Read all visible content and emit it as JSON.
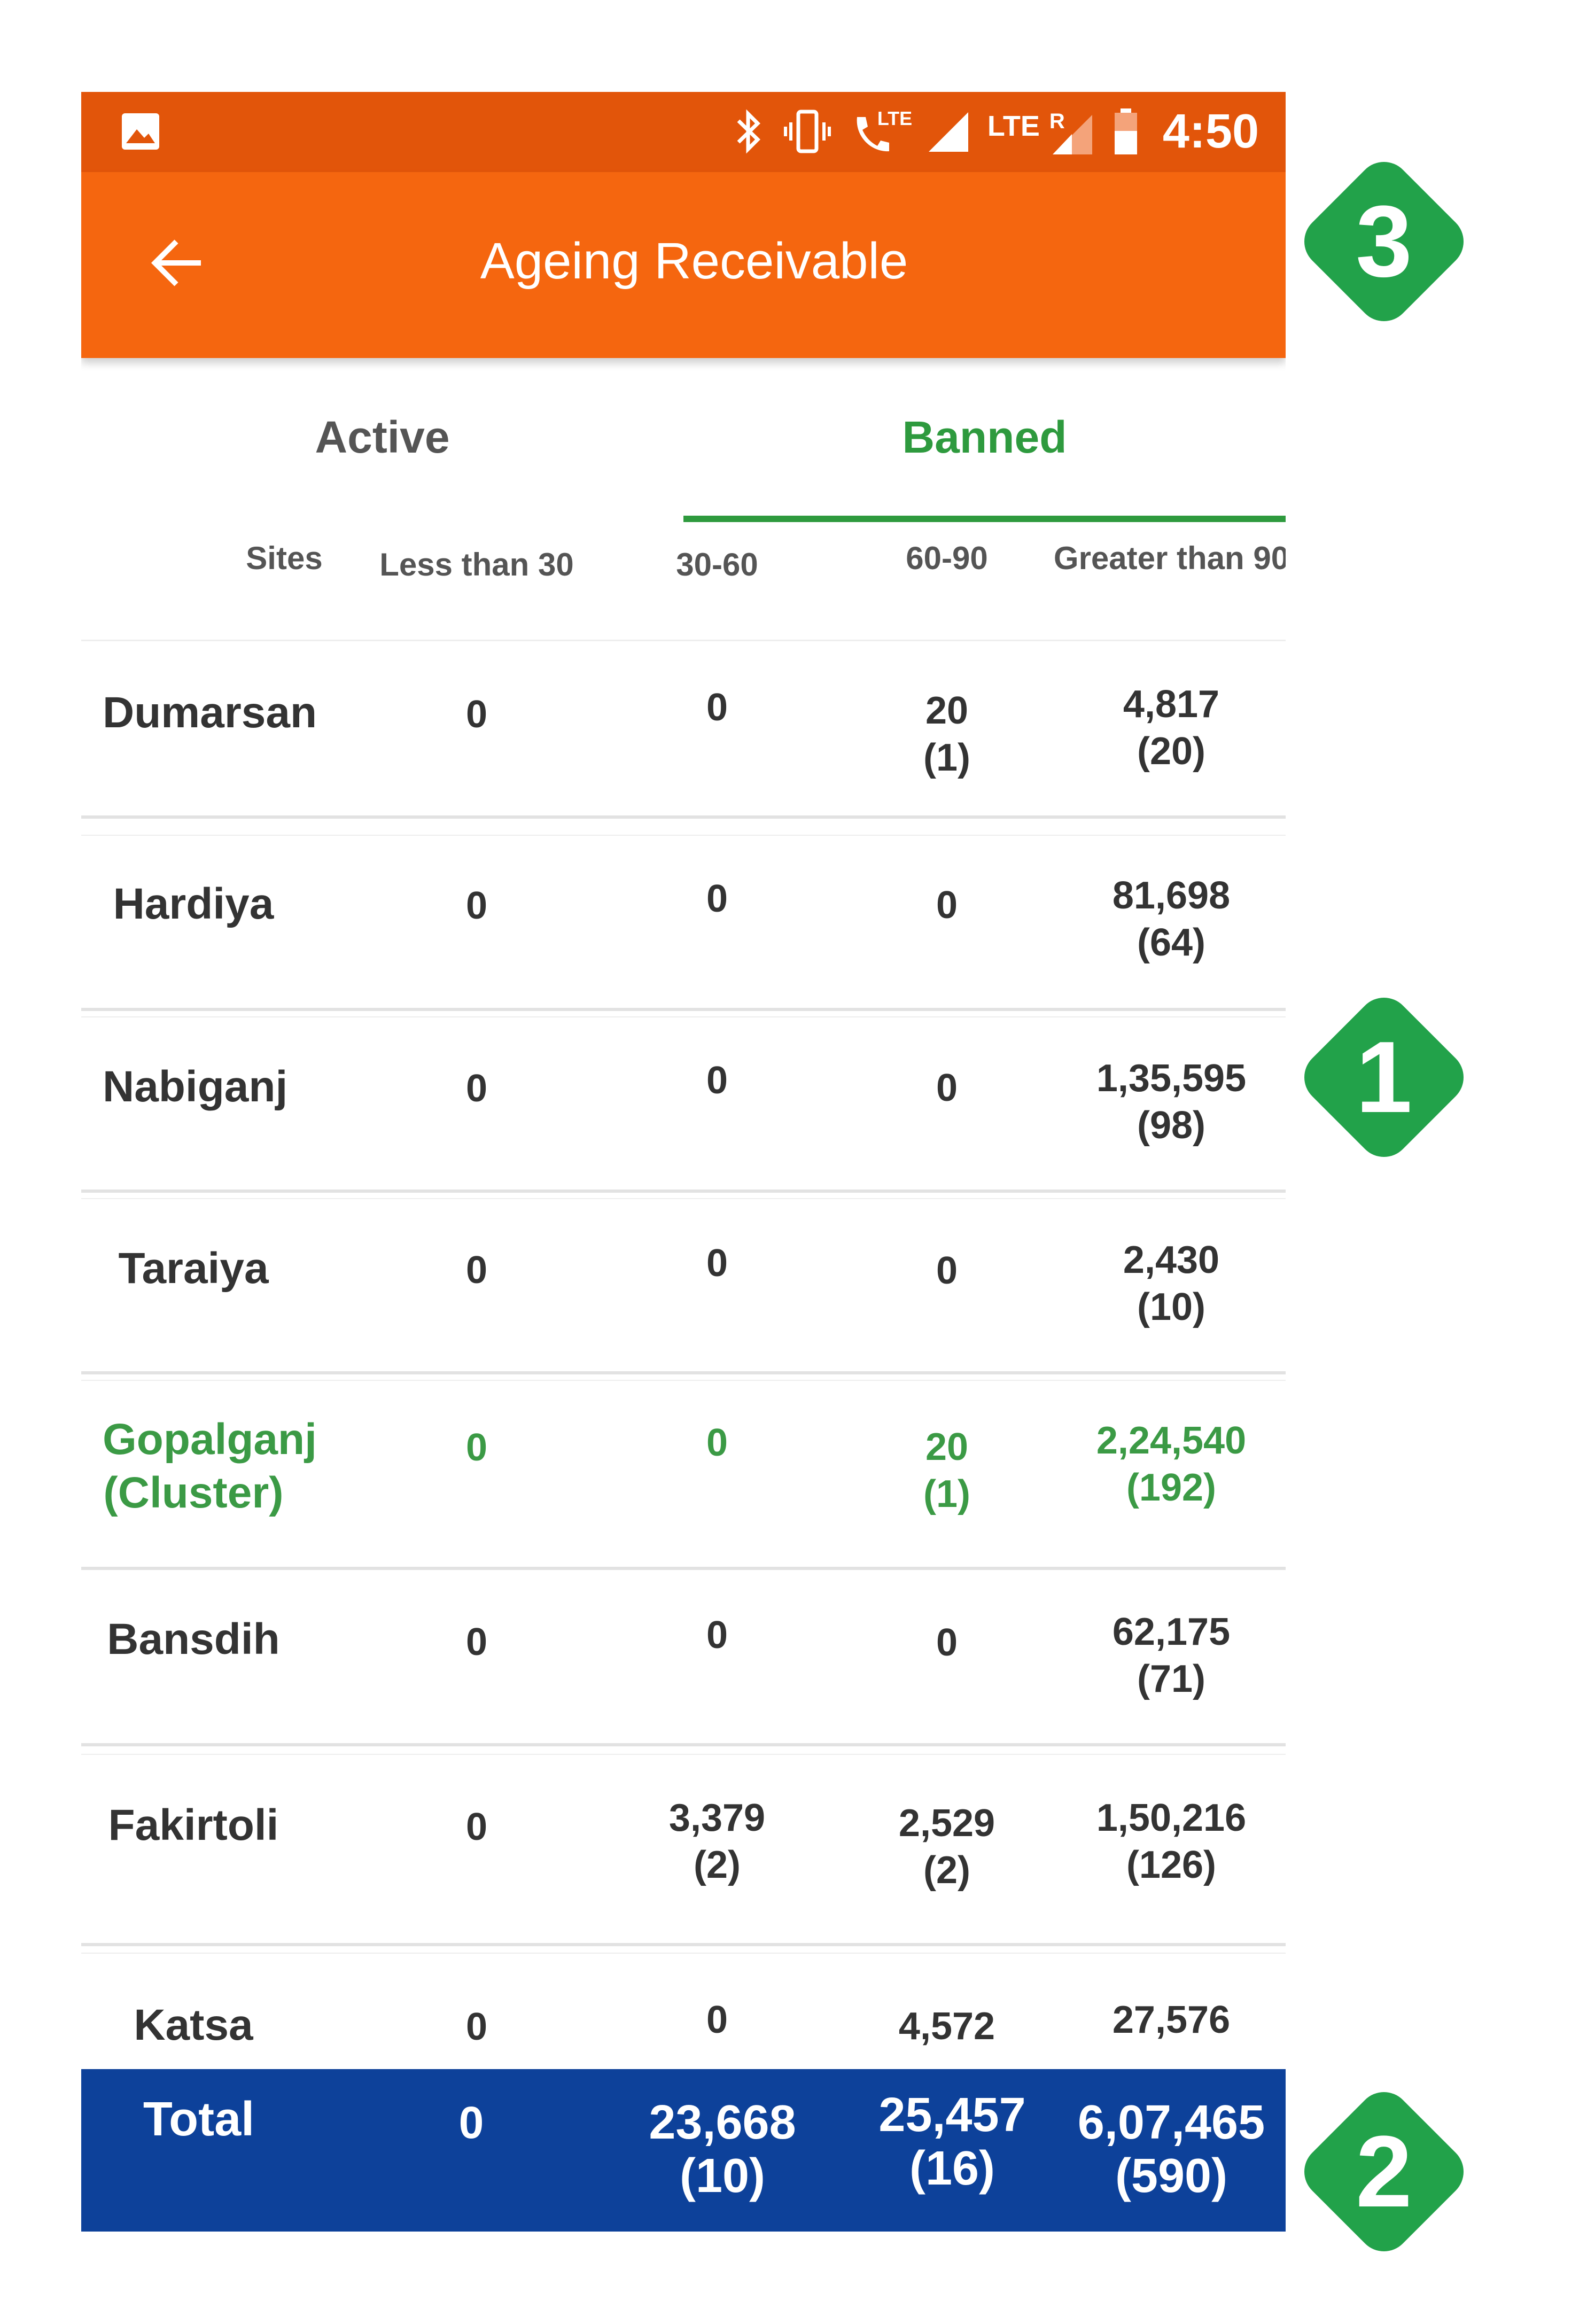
{
  "status_bar": {
    "time": "4:50",
    "lte_label": "LTE",
    "lte_label_2": "LTE",
    "roaming": "R"
  },
  "app_bar": {
    "title": "Ageing Receivable"
  },
  "tabs": [
    {
      "label": "Active",
      "selected": false
    },
    {
      "label": "Banned",
      "selected": true
    }
  ],
  "table": {
    "headers": [
      "Sites",
      "Less than 30",
      "30-60",
      "60-90",
      "Greater than 90"
    ],
    "rows": [
      {
        "site": "Dumarsan",
        "lt30": "0",
        "d30_60": "0",
        "d60_90": "20\n(1)",
        "gt90": "4,817\n(20)",
        "highlight": false
      },
      {
        "site": "Hardiya",
        "lt30": "0",
        "d30_60": "0",
        "d60_90": "0",
        "gt90": "81,698\n(64)",
        "highlight": false
      },
      {
        "site": "Nabiganj",
        "lt30": "0",
        "d30_60": "0",
        "d60_90": "0",
        "gt90": "1,35,595\n(98)",
        "highlight": false
      },
      {
        "site": "Taraiya",
        "lt30": "0",
        "d30_60": "0",
        "d60_90": "0",
        "gt90": "2,430\n(10)",
        "highlight": false
      },
      {
        "site": "Gopalganj\n(Cluster)",
        "lt30": "0",
        "d30_60": "0",
        "d60_90": "20\n(1)",
        "gt90": "2,24,540\n(192)",
        "highlight": true
      },
      {
        "site": "Bansdih",
        "lt30": "0",
        "d30_60": "0",
        "d60_90": "0",
        "gt90": "62,175\n(71)",
        "highlight": false
      },
      {
        "site": "Fakirtoli",
        "lt30": "0",
        "d30_60": "3,379\n(2)",
        "d60_90": "2,529\n(2)",
        "gt90": "1,50,216\n(126)",
        "highlight": false
      },
      {
        "site": "Katsa",
        "lt30": "0",
        "d30_60": "0",
        "d60_90": "4,572",
        "gt90": "27,576",
        "highlight": false
      }
    ],
    "total": {
      "label": "Total",
      "lt30": "0",
      "d30_60": "23,668\n(10)",
      "d60_90": "25,457\n(16)",
      "gt90": "6,07,465\n(590)"
    }
  },
  "callouts": {
    "header": "3",
    "rows": "1",
    "total": "2"
  },
  "colors": {
    "status_bar": "#e2550a",
    "app_bar": "#f5660f",
    "accent_green": "#2e9a3e",
    "total_bar": "#0d419a",
    "badge": "#22a24a"
  }
}
